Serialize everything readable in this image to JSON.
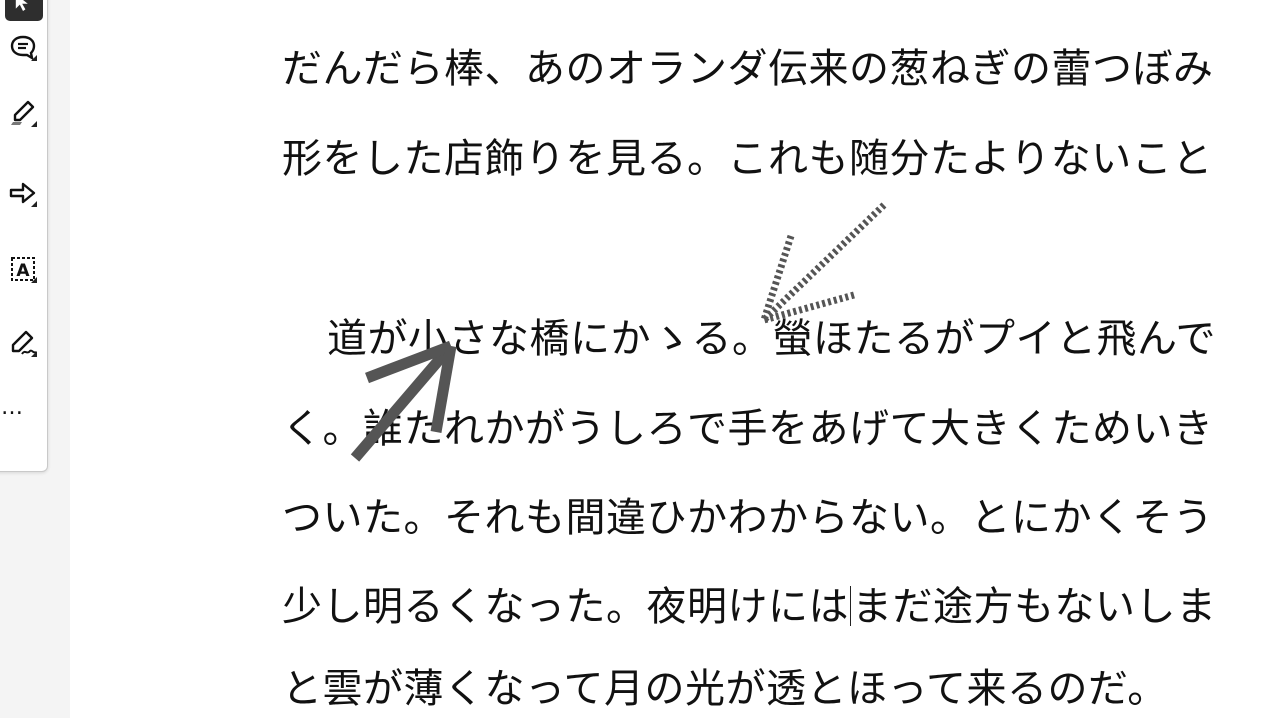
{
  "toolbar": {
    "tools": [
      {
        "name": "select-tool",
        "icon": "select-icon"
      },
      {
        "name": "comment-tool",
        "icon": "comment-icon"
      },
      {
        "name": "highlight-tool",
        "icon": "highlighter-icon"
      },
      {
        "name": "arrow-tool",
        "icon": "arrow-right-icon"
      },
      {
        "name": "text-box-tool",
        "icon": "text-box-icon",
        "glyph": "A"
      },
      {
        "name": "signature-tool",
        "icon": "signature-icon"
      }
    ],
    "more_label": "…"
  },
  "document": {
    "lines": [
      "だんだら棒、あのオランダ伝来の葱ねぎの蕾つぼみ",
      "形をした店飾りを見る。これも随分たよりないこと",
      "道が小さな橋にかゝる。螢ほたるがプイと飛んで",
      "く。誰たれかがうしろで手をあげて大きくためいき",
      "ついた。それも間違ひかわからない。とにかくそう",
      "少し明るくなった。夜明けには",
      "まだ途方もないしま",
      "と雲が薄くなって月の光が透とほって来るのだ。"
    ]
  },
  "colors": {
    "annotation_stroke": "#555555",
    "toolbar_active_bg": "#2e2e2e"
  }
}
